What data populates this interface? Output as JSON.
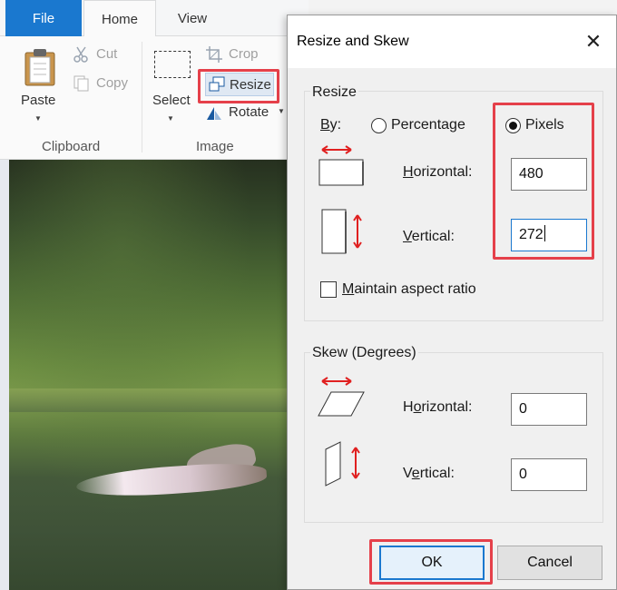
{
  "paint": {
    "tabs": {
      "file": "File",
      "home": "Home",
      "view": "View"
    },
    "clipboard": {
      "paste": "Paste",
      "cut": "Cut",
      "copy": "Copy",
      "group": "Clipboard"
    },
    "image": {
      "select": "Select",
      "crop": "Crop",
      "resize": "Resize",
      "rotate": "Rotate",
      "group": "Image"
    }
  },
  "dialog": {
    "title": "Resize and Skew",
    "close_glyph": "✕",
    "resize": {
      "title": "Resize",
      "by_label": "By:",
      "percentage": "Percentage",
      "pixels": "Pixels",
      "selected": "pixels",
      "horizontal_label": "Horizontal:",
      "horizontal_value": "480",
      "vertical_label": "Vertical:",
      "vertical_value": "272",
      "maintain": "Maintain aspect ratio",
      "maintain_checked": false
    },
    "skew": {
      "title": "Skew (Degrees)",
      "horizontal_label": "Horizontal:",
      "horizontal_value": "0",
      "vertical_label": "Vertical:",
      "vertical_value": "0"
    },
    "buttons": {
      "ok": "OK",
      "cancel": "Cancel"
    }
  },
  "colors": {
    "accent": "#1a78cf",
    "highlight": "#e5404a",
    "arrow": "#e02020"
  }
}
